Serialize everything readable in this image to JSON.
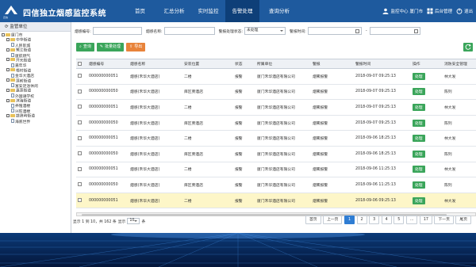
{
  "header": {
    "brand_word": "四信",
    "title": "四信独立烟感监控系统",
    "nav": [
      {
        "label": "首页",
        "active": false
      },
      {
        "label": "汇总分析",
        "active": false
      },
      {
        "label": "实时监控",
        "active": false
      },
      {
        "label": "告警处理",
        "active": true
      },
      {
        "label": "查询分析",
        "active": false
      }
    ],
    "user": {
      "account_label": "监控中心",
      "unit_label": "厦门市",
      "admin_label": "后台管理",
      "logout_label": "退出"
    }
  },
  "sidebar": {
    "title": "监管单位",
    "tree": [
      {
        "label": "厦门市",
        "level": 0,
        "kind": "folder"
      },
      {
        "label": "中华街道",
        "level": 1,
        "kind": "folder"
      },
      {
        "label": "人民影城",
        "level": 2,
        "kind": "file"
      },
      {
        "label": "鹭江街道",
        "level": 1,
        "kind": "folder"
      },
      {
        "label": "厦航燃气",
        "level": 2,
        "kind": "file"
      },
      {
        "label": "开元街道",
        "level": 1,
        "kind": "folder"
      },
      {
        "label": "嘉年华",
        "level": 2,
        "kind": "file"
      },
      {
        "label": "梧村街道",
        "level": 1,
        "kind": "folder"
      },
      {
        "label": "金华大酒店",
        "level": 2,
        "kind": "file"
      },
      {
        "label": "莲前街道",
        "level": 1,
        "kind": "folder"
      },
      {
        "label": "富安足浴休闲",
        "level": 2,
        "kind": "file"
      },
      {
        "label": "嘉莲街道",
        "level": 1,
        "kind": "folder"
      },
      {
        "label": "外国语学校",
        "level": 2,
        "kind": "file"
      },
      {
        "label": "滨海街道",
        "level": 1,
        "kind": "folder"
      },
      {
        "label": "养殖酒楼",
        "level": 2,
        "kind": "file"
      },
      {
        "label": "兴旺酒楼",
        "level": 2,
        "kind": "file"
      },
      {
        "label": "鼓浪屿街道",
        "level": 1,
        "kind": "folder"
      },
      {
        "label": "海底世界",
        "level": 2,
        "kind": "file"
      }
    ]
  },
  "filters": {
    "sensor_no_label": "烟感编号:",
    "sensor_no_value": "",
    "sensor_name_label": "烟感名称:",
    "sensor_name_value": "",
    "status_label": "警报处理状态:",
    "status_value": "未处理",
    "time_label": "警报时间:",
    "time_sep": "-"
  },
  "actions": {
    "search": "查询",
    "batch": "批量处理",
    "export": "导出"
  },
  "table": {
    "columns": [
      "",
      "烟感编号",
      "烟感名称",
      "安装位置",
      "状态",
      "所属单位",
      "警报",
      "警报时间",
      "操作",
      "消防安全管理"
    ],
    "rows": [
      {
        "no": "000000000051",
        "name": "烟感(禾华大酒店)",
        "loc": "二楼",
        "status": "报警",
        "unit": "厦门禾华酒店有限公司",
        "alarm": "烟雾报警",
        "time": "2018-09-07 09:25:13",
        "action": "处理",
        "owner": "林大发",
        "selected": false
      },
      {
        "no": "000000000050",
        "name": "烟感(禾华大酒店)",
        "loc": "库区旁酒店",
        "status": "报警",
        "unit": "厦门禾华酒店有限公司",
        "alarm": "烟雾报警",
        "time": "2018-09-07 09:25:13",
        "action": "处理",
        "owner": "陈列",
        "selected": false
      },
      {
        "no": "000000000051",
        "name": "烟感(禾华大酒店)",
        "loc": "二楼",
        "status": "报警",
        "unit": "厦门禾华酒店有限公司",
        "alarm": "烟雾报警",
        "time": "2018-09-07 09:25:13",
        "action": "处理",
        "owner": "林大发",
        "selected": false
      },
      {
        "no": "000000000050",
        "name": "烟感(禾华大酒店)",
        "loc": "库区旁酒店",
        "status": "报警",
        "unit": "厦门禾华酒店有限公司",
        "alarm": "烟雾报警",
        "time": "2018-09-07 09:25:13",
        "action": "处理",
        "owner": "陈列",
        "selected": false
      },
      {
        "no": "000000000051",
        "name": "烟感(禾华大酒店)",
        "loc": "二楼",
        "status": "报警",
        "unit": "厦门禾华酒店有限公司",
        "alarm": "烟雾报警",
        "time": "2018-09-06 18:25:13",
        "action": "处理",
        "owner": "林大发",
        "selected": false
      },
      {
        "no": "000000000050",
        "name": "烟感(禾华大酒店)",
        "loc": "库区旁酒店",
        "status": "报警",
        "unit": "厦门禾华酒店有限公司",
        "alarm": "烟雾报警",
        "time": "2018-09-06 18:25:13",
        "action": "处理",
        "owner": "陈列",
        "selected": false
      },
      {
        "no": "000000000051",
        "name": "烟感(禾华大酒店)",
        "loc": "二楼",
        "status": "报警",
        "unit": "厦门禾华酒店有限公司",
        "alarm": "烟雾报警",
        "time": "2018-09-06 11:25:13",
        "action": "处理",
        "owner": "林大发",
        "selected": false
      },
      {
        "no": "000000000050",
        "name": "烟感(禾华大酒店)",
        "loc": "库区旁酒店",
        "status": "报警",
        "unit": "厦门禾华酒店有限公司",
        "alarm": "烟雾报警",
        "time": "2018-09-06 11:25:13",
        "action": "处理",
        "owner": "陈列",
        "selected": false
      },
      {
        "no": "000000000051",
        "name": "烟感(禾华大酒店)",
        "loc": "二楼",
        "status": "报警",
        "unit": "厦门禾华酒店有限公司",
        "alarm": "烟雾报警",
        "time": "2018-09-06 09:25:13",
        "action": "处理",
        "owner": "林大发",
        "selected": true
      }
    ]
  },
  "footer": {
    "summary_prefix": "显示 1 到 10，共 162 条",
    "show_label": "显示",
    "page_size": "10",
    "unit_label": "条",
    "pager": [
      "首页",
      "上一页",
      "1",
      "2",
      "3",
      "4",
      "5",
      "...",
      "17",
      "下一页",
      "尾页"
    ],
    "current_page": "1"
  },
  "colors": {
    "header": "#1e5a9e",
    "active_nav": "#0e3f78",
    "green": "#3aa55a",
    "orange": "#e8833a",
    "selected_row": "#fdf6c8"
  }
}
